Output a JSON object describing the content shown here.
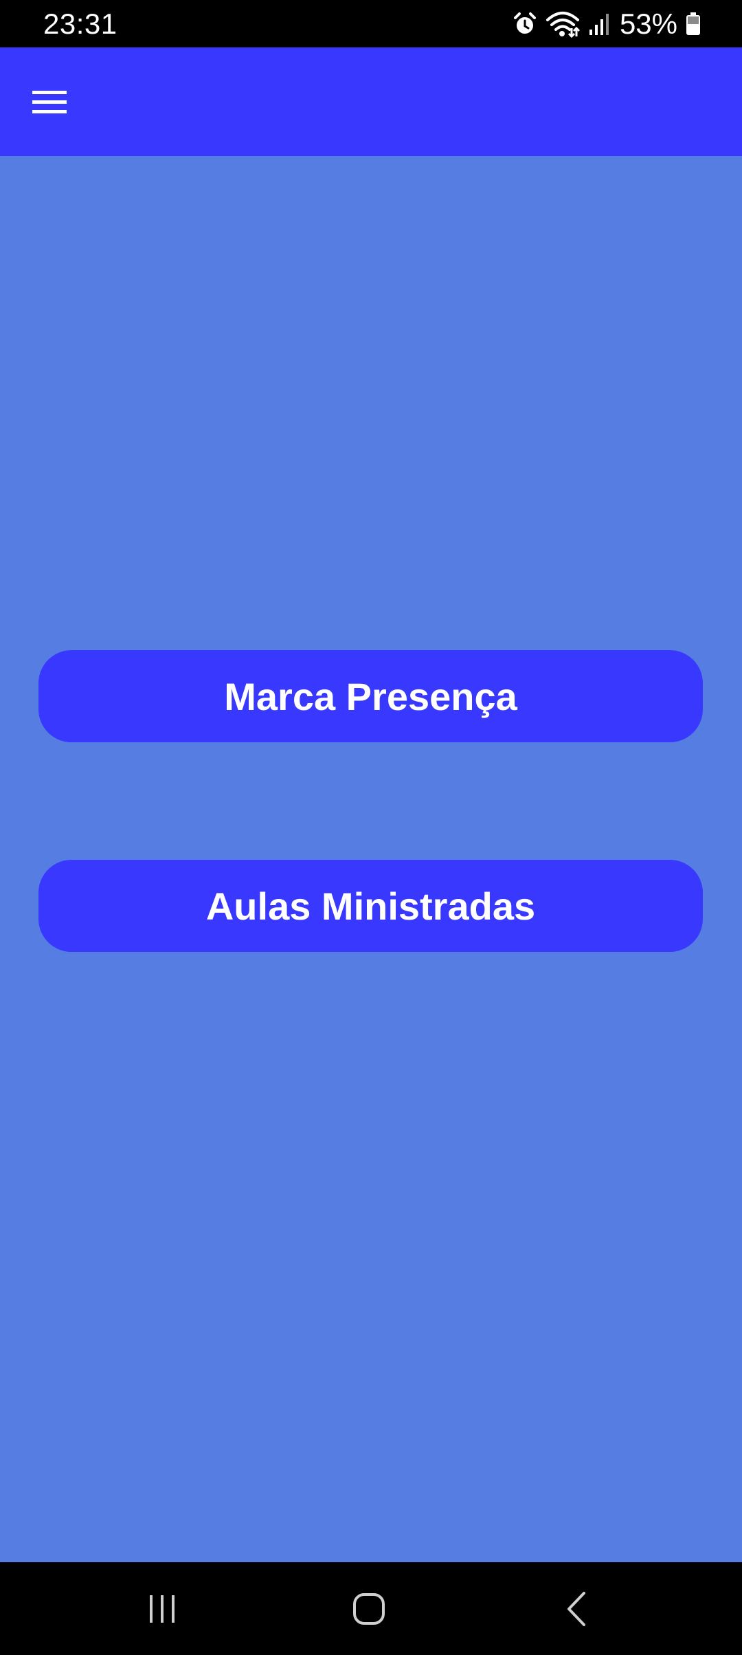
{
  "status_bar": {
    "time": "23:31",
    "battery_percent": "53%",
    "icons": [
      "alarm-icon",
      "wifi-icon",
      "signal-icon",
      "battery-icon"
    ]
  },
  "app_bar": {
    "menu_icon": "hamburger-menu-icon",
    "color": "#3838FF"
  },
  "main": {
    "background": "#557DE2",
    "buttons": [
      {
        "label": "Marca Presença"
      },
      {
        "label": "Aulas Ministradas"
      }
    ]
  },
  "nav_bar": {
    "items": [
      "recents-icon",
      "home-icon",
      "back-icon"
    ]
  }
}
